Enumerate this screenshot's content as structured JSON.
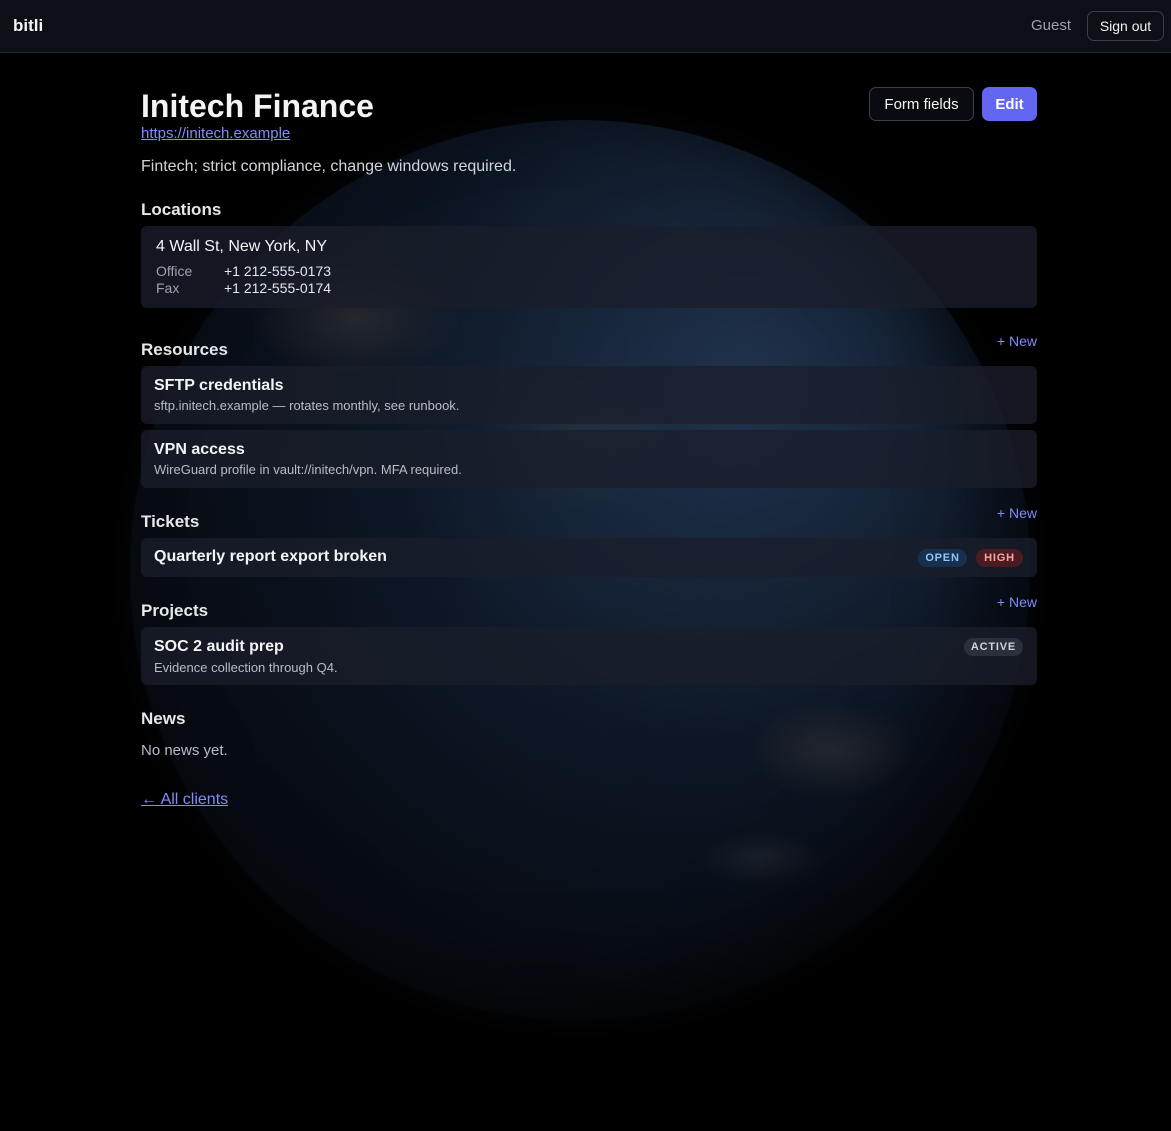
{
  "nav": {
    "brand": "bitli",
    "user": "Guest",
    "sign_out": "Sign out"
  },
  "client": {
    "name": "Initech Finance",
    "url": "https://initech.example",
    "description": "Fintech; strict compliance, change windows required.",
    "form_fields_label": "Form fields",
    "edit_label": "Edit"
  },
  "locations": {
    "title": "Locations",
    "items": [
      {
        "address": "4 Wall St, New York, NY",
        "phones": [
          {
            "label": "Office",
            "value": "+1 212-555-0173"
          },
          {
            "label": "Fax",
            "value": "+1 212-555-0174"
          }
        ]
      }
    ]
  },
  "resources": {
    "title": "Resources",
    "new_label": "+ New",
    "items": [
      {
        "title": "SFTP credentials",
        "subtitle": "sftp.initech.example — rotates monthly, see runbook."
      },
      {
        "title": "VPN access",
        "subtitle": "WireGuard profile in vault://initech/vpn. MFA required."
      }
    ]
  },
  "tickets": {
    "title": "Tickets",
    "new_label": "+ New",
    "items": [
      {
        "title": "Quarterly report export broken",
        "status": "OPEN",
        "priority": "HIGH"
      }
    ]
  },
  "projects": {
    "title": "Projects",
    "new_label": "+ New",
    "items": [
      {
        "title": "SOC 2 audit prep",
        "subtitle": "Evidence collection through Q4.",
        "status": "ACTIVE"
      }
    ]
  },
  "news": {
    "title": "News",
    "empty": "No news yet."
  },
  "back_link": "← All clients",
  "colors": {
    "accent": "#6366f1",
    "link": "#818cf8",
    "background": "#000000",
    "topbar": "#0d0f17",
    "card": "#1a1e2a"
  }
}
